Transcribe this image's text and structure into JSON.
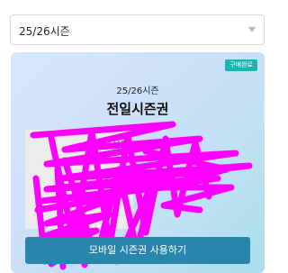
{
  "season_select": {
    "value": "25/26시즌"
  },
  "card": {
    "badge": "구매완료",
    "season": "25/26시즌",
    "title": "전일시즌권",
    "partial_text": "일 시즌"
  },
  "use_button": "모바일 시즌권 사용하기",
  "colors": {
    "badge": "#18b6b2",
    "button": "#2a85ad",
    "redaction": "#ff00ff"
  }
}
